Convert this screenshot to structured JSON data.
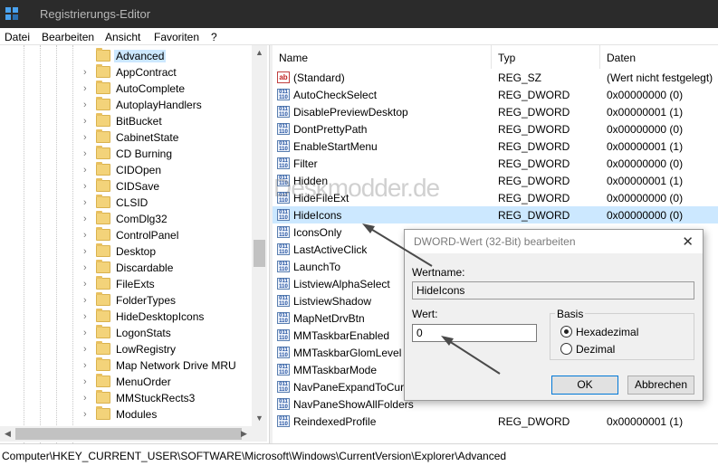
{
  "window": {
    "title": "Registrierungs-Editor"
  },
  "menu": [
    "Datei",
    "Bearbeiten",
    "Ansicht",
    "Favoriten",
    "?"
  ],
  "tree": {
    "items": [
      {
        "label": "Advanced",
        "selected": true
      },
      {
        "label": "AppContract"
      },
      {
        "label": "AutoComplete"
      },
      {
        "label": "AutoplayHandlers"
      },
      {
        "label": "BitBucket"
      },
      {
        "label": "CabinetState"
      },
      {
        "label": "CD Burning"
      },
      {
        "label": "CIDOpen"
      },
      {
        "label": "CIDSave"
      },
      {
        "label": "CLSID"
      },
      {
        "label": "ComDlg32"
      },
      {
        "label": "ControlPanel"
      },
      {
        "label": "Desktop"
      },
      {
        "label": "Discardable"
      },
      {
        "label": "FileExts"
      },
      {
        "label": "FolderTypes"
      },
      {
        "label": "HideDesktopIcons"
      },
      {
        "label": "LogonStats"
      },
      {
        "label": "LowRegistry"
      },
      {
        "label": "Map Network Drive MRU"
      },
      {
        "label": "MenuOrder"
      },
      {
        "label": "MMStuckRects3"
      },
      {
        "label": "Modules"
      }
    ]
  },
  "list": {
    "headers": [
      "Name",
      "Typ",
      "Daten"
    ],
    "rows": [
      {
        "name": "(Standard)",
        "type": "REG_SZ",
        "data": "(Wert nicht festgelegt)",
        "icon": "string-value-icon"
      },
      {
        "name": "AutoCheckSelect",
        "type": "REG_DWORD",
        "data": "0x00000000 (0)",
        "icon": "dword-value-icon"
      },
      {
        "name": "DisablePreviewDesktop",
        "type": "REG_DWORD",
        "data": "0x00000001 (1)",
        "icon": "dword-value-icon"
      },
      {
        "name": "DontPrettyPath",
        "type": "REG_DWORD",
        "data": "0x00000000 (0)",
        "icon": "dword-value-icon"
      },
      {
        "name": "EnableStartMenu",
        "type": "REG_DWORD",
        "data": "0x00000001 (1)",
        "icon": "dword-value-icon"
      },
      {
        "name": "Filter",
        "type": "REG_DWORD",
        "data": "0x00000000 (0)",
        "icon": "dword-value-icon"
      },
      {
        "name": "Hidden",
        "type": "REG_DWORD",
        "data": "0x00000001 (1)",
        "icon": "dword-value-icon"
      },
      {
        "name": "HideFileExt",
        "type": "REG_DWORD",
        "data": "0x00000000 (0)",
        "icon": "dword-value-icon"
      },
      {
        "name": "HideIcons",
        "type": "REG_DWORD",
        "data": "0x00000000 (0)",
        "icon": "dword-value-icon",
        "selected": true
      },
      {
        "name": "IconsOnly",
        "type": "",
        "data": "",
        "icon": "dword-value-icon"
      },
      {
        "name": "LastActiveClick",
        "type": "",
        "data": "",
        "icon": "dword-value-icon"
      },
      {
        "name": "LaunchTo",
        "type": "",
        "data": "",
        "icon": "dword-value-icon"
      },
      {
        "name": "ListviewAlphaSelect",
        "type": "",
        "data": "",
        "icon": "dword-value-icon"
      },
      {
        "name": "ListviewShadow",
        "type": "",
        "data": "",
        "icon": "dword-value-icon"
      },
      {
        "name": "MapNetDrvBtn",
        "type": "",
        "data": "",
        "icon": "dword-value-icon"
      },
      {
        "name": "MMTaskbarEnabled",
        "type": "",
        "data": "",
        "icon": "dword-value-icon"
      },
      {
        "name": "MMTaskbarGlomLevel",
        "type": "",
        "data": "",
        "icon": "dword-value-icon"
      },
      {
        "name": "MMTaskbarMode",
        "type": "",
        "data": "",
        "icon": "dword-value-icon"
      },
      {
        "name": "NavPaneExpandToCurr",
        "type": "",
        "data": "",
        "icon": "dword-value-icon"
      },
      {
        "name": "NavPaneShowAllFolders",
        "type": "",
        "data": "",
        "icon": "dword-value-icon"
      },
      {
        "name": "ReindexedProfile",
        "type": "REG_DWORD",
        "data": "0x00000001 (1)",
        "icon": "dword-value-icon"
      }
    ]
  },
  "watermark": "Deskmodder.de",
  "status": {
    "path": "Computer\\HKEY_CURRENT_USER\\SOFTWARE\\Microsoft\\Windows\\CurrentVersion\\Explorer\\Advanced"
  },
  "dialog": {
    "title": "DWORD-Wert (32-Bit) bearbeiten",
    "name_label": "Wertname:",
    "name_value": "HideIcons",
    "value_label": "Wert:",
    "value_value": "0",
    "basis_label": "Basis",
    "hex_label": "Hexadezimal",
    "dec_label": "Dezimal",
    "hex_selected": true,
    "ok_label": "OK",
    "cancel_label": "Abbrechen"
  }
}
